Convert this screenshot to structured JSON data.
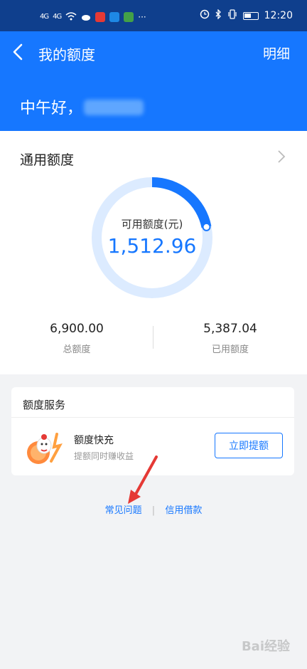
{
  "status_bar": {
    "network_labels": [
      "4G",
      "4G"
    ],
    "time": "12:20",
    "app_icons": [
      "red-app-icon",
      "blue-app-icon",
      "green-app-icon"
    ]
  },
  "header": {
    "title": "我的额度",
    "right_action": "明细",
    "greeting": "中午好，"
  },
  "credit": {
    "section_title": "通用额度",
    "available_label": "可用额度(元)",
    "available_value": "1,512.96",
    "available_fraction": 0.219,
    "total_value": "6,900.00",
    "total_label": "总额度",
    "used_value": "5,387.04",
    "used_label": "已用额度"
  },
  "service": {
    "section_title": "额度服务",
    "item_name": "额度快充",
    "item_desc": "提额同时赚收益",
    "button_label": "立即提额"
  },
  "links": {
    "faq": "常见问题",
    "credit_loan": "信用借款",
    "separator": "|"
  },
  "watermark": "Bai经验",
  "colors": {
    "primary": "#1677ff",
    "status_bar": "#0f3f8d",
    "ring_track": "#dcebff",
    "annotation_arrow": "#e53935"
  }
}
